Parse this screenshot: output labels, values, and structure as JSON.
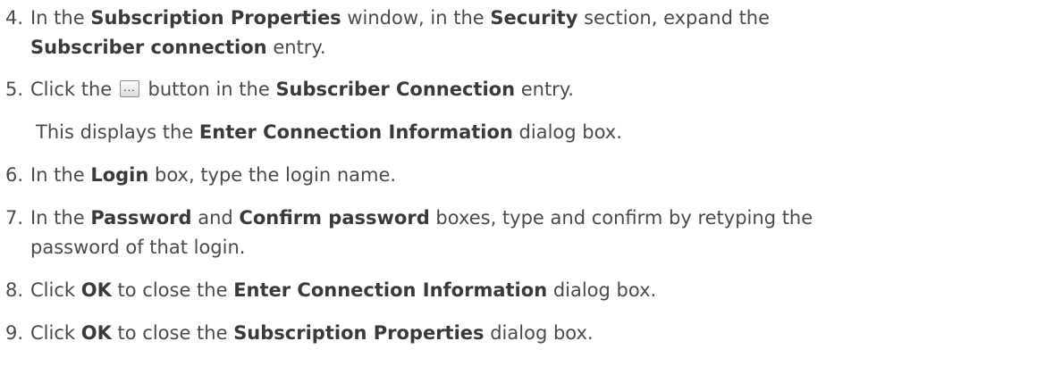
{
  "steps": [
    {
      "num": "4.",
      "lines": [
        [
          {
            "t": "In the ",
            "b": false
          },
          {
            "t": "Subscription Properties",
            "b": true
          },
          {
            "t": " window, in the ",
            "b": false
          },
          {
            "t": "Security",
            "b": true
          },
          {
            "t": " section, expand the",
            "b": false
          }
        ],
        [
          {
            "t": "Subscriber connection",
            "b": true
          },
          {
            "t": " entry.",
            "b": false
          }
        ]
      ]
    },
    {
      "num": "5.",
      "before": "Click the ",
      "icon": "ellipsis-button-icon",
      "after": " button in the ",
      "bold": "Subscriber Connection",
      "end": " entry."
    },
    {
      "note": [
        {
          "t": "This displays the ",
          "b": false
        },
        {
          "t": "Enter Connection Information",
          "b": true
        },
        {
          "t": " dialog box.",
          "b": false
        }
      ]
    },
    {
      "num": "6.",
      "lines": [
        [
          {
            "t": "In the ",
            "b": false
          },
          {
            "t": "Login",
            "b": true
          },
          {
            "t": " box, type the login name.",
            "b": false
          }
        ]
      ]
    },
    {
      "num": "7.",
      "lines": [
        [
          {
            "t": "In the ",
            "b": false
          },
          {
            "t": "Password",
            "b": true
          },
          {
            "t": " and ",
            "b": false
          },
          {
            "t": "Confirm password",
            "b": true
          },
          {
            "t": " boxes, type and confirm by retyping the",
            "b": false
          }
        ],
        [
          {
            "t": "password of that login.",
            "b": false
          }
        ]
      ]
    },
    {
      "num": "8.",
      "lines": [
        [
          {
            "t": "Click ",
            "b": false
          },
          {
            "t": "OK",
            "b": true
          },
          {
            "t": " to close the ",
            "b": false
          },
          {
            "t": "Enter Connection Information",
            "b": true
          },
          {
            "t": " dialog box.",
            "b": false
          }
        ]
      ]
    },
    {
      "num": "9.",
      "lines": [
        [
          {
            "t": "Click ",
            "b": false
          },
          {
            "t": "OK",
            "b": true
          },
          {
            "t": " to close the ",
            "b": false
          },
          {
            "t": "Subscription Properties",
            "b": true
          },
          {
            "t": " dialog box.",
            "b": false
          }
        ]
      ]
    }
  ]
}
